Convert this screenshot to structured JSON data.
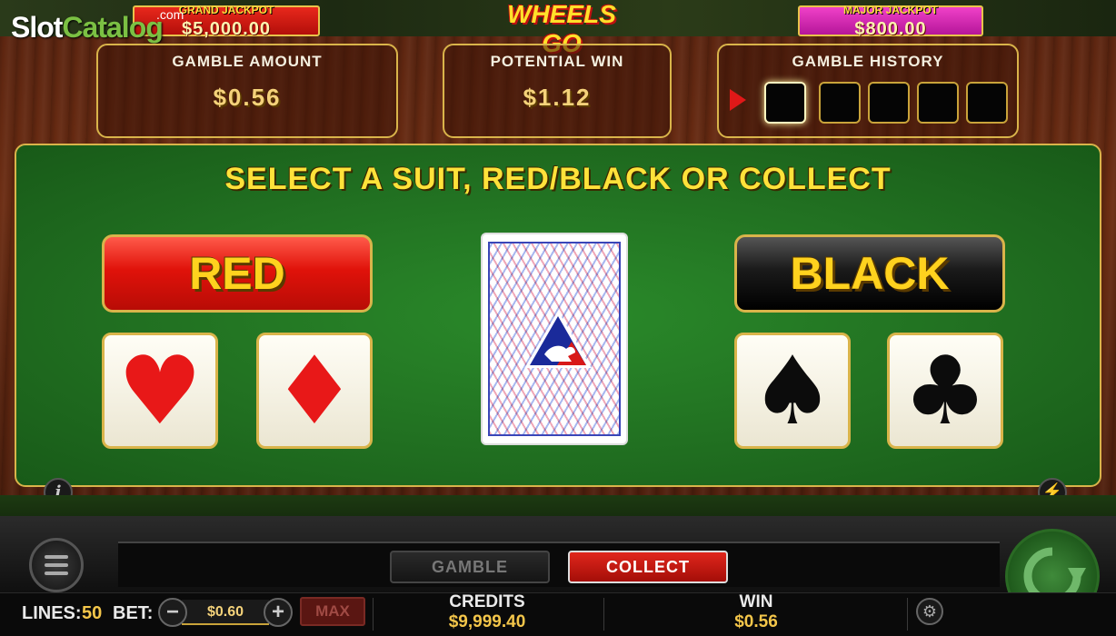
{
  "header": {
    "grand_jackpot_label": "GRAND JACKPOT",
    "grand_jackpot_value": "$5,000.00",
    "major_jackpot_label": "MAJOR JACKPOT",
    "major_jackpot_value": "$800.00",
    "logo_text": "WHEELS GO",
    "watermark_a": "Slot",
    "watermark_b": "Catalog",
    "watermark_com": ".com"
  },
  "gamble": {
    "amount_label": "GAMBLE AMOUNT",
    "amount_value": "$0.56",
    "potential_label": "POTENTIAL WIN",
    "potential_value": "$1.12",
    "history_label": "GAMBLE HISTORY",
    "history_slots": 5,
    "prompt": "SELECT A SUIT, RED/BLACK OR COLLECT",
    "red_label": "RED",
    "black_label": "BLACK",
    "suits": {
      "hearts": "♥",
      "diamonds": "♦",
      "spades": "♠",
      "clubs": "♣"
    }
  },
  "console": {
    "gamble_button": "GAMBLE",
    "collect_button": "COLLECT",
    "lines_label": "LINES:",
    "lines_value": "50",
    "bet_label": "BET:",
    "bet_value": "$0.60",
    "max_label": "MAX",
    "credits_label": "CREDITS",
    "credits_value": "$9,999.40",
    "win_label": "WIN",
    "win_value": "$0.56"
  },
  "colors": {
    "felt": "#217021",
    "gold_border": "#d9b44a",
    "red_button": "#e0120a",
    "collect_button": "#a40e08"
  },
  "icons": [
    "menu-icon",
    "info-icon",
    "turbo-icon",
    "spin-icon",
    "settings-icon",
    "minus-icon",
    "plus-icon",
    "arrow-icon"
  ]
}
